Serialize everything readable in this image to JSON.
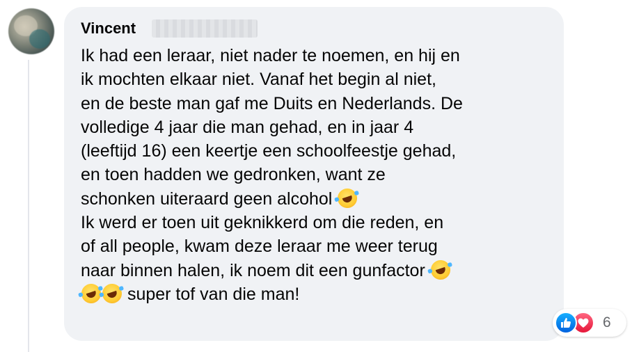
{
  "comment": {
    "author": "Vincent",
    "lines": [
      "Ik had een leraar, niet nader te noemen, en hij en",
      "ik mochten elkaar niet. Vanaf het begin al niet,",
      "en de beste man gaf me Duits en Nederlands. De",
      "volledige 4 jaar die man gehad, en in jaar 4",
      "(leeftijd 16) een keertje een schoolfeestje gehad,",
      "en toen hadden we gedronken, want ze",
      "schonken uiteraard geen alcohol",
      "Ik werd er toen uit geknikkerd om die reden, en",
      "of all people, kwam deze leraar me weer terug",
      "naar binnen halen, ik noem dit een gunfactor",
      "super tof van die man!"
    ],
    "emoji": "rolling-on-floor-laughing"
  },
  "reactions": {
    "types": [
      "like",
      "love"
    ],
    "count": "6"
  },
  "colors": {
    "bubble": "#f0f2f5",
    "like": "#0866ff",
    "love": "#f33e58",
    "muted_text": "#65676b"
  }
}
